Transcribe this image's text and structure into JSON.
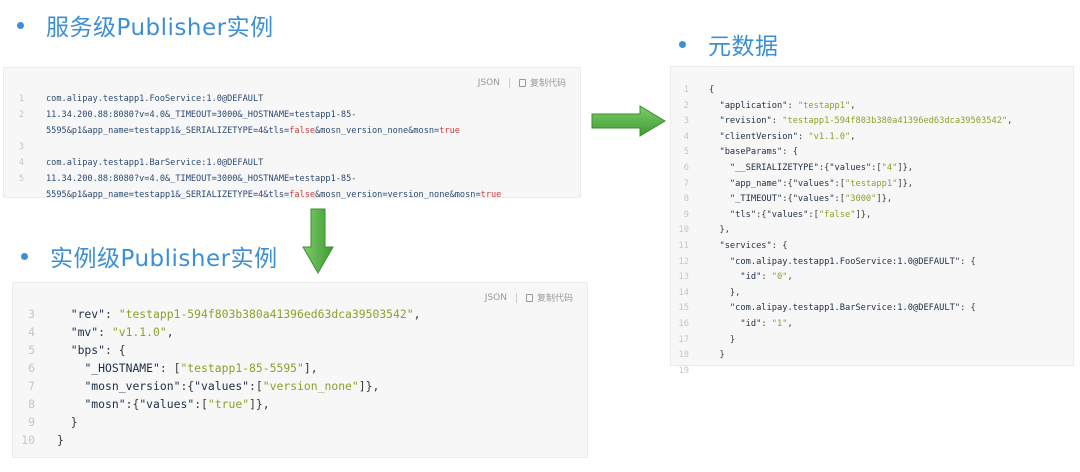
{
  "headings": {
    "service_publisher": "服务级Publisher实例",
    "instance_publisher": "实例级Publisher实例",
    "metadata": "元数据"
  },
  "toolbar": {
    "json_label": "JSON",
    "copy_label": "复制代码"
  },
  "service_panel": {
    "lines": [
      {
        "n": "1",
        "t": [
          [
            "com.alipay.testapp1.FooService:1.0@DEFAULT",
            "d"
          ]
        ]
      },
      {
        "n": "2",
        "t": [
          [
            "11.34.200.88:8080?v=4.0&_TIMEOUT=3000&_HOSTNAME=testapp1-85-",
            "d"
          ]
        ]
      },
      {
        "n": "",
        "t": [
          [
            "5595&p1&app_name=testapp1&_SERIALIZETYPE=4&tls=",
            "d"
          ],
          [
            "false",
            "b"
          ],
          [
            "&mosn_version_none&mosn=",
            "d"
          ],
          [
            "true",
            "b"
          ]
        ]
      },
      {
        "n": "3",
        "t": []
      },
      {
        "n": "4",
        "t": [
          [
            "com.alipay.testapp1.BarService:1.0@DEFAULT",
            "d"
          ]
        ]
      },
      {
        "n": "5",
        "t": [
          [
            "11.34.200.88:8080?v=4.0&_TIMEOUT=3000&_HOSTNAME=testapp1-85-",
            "d"
          ]
        ]
      },
      {
        "n": "",
        "t": [
          [
            "5595&p1&app_name=testapp1&_SERIALIZETYPE=4&tls=",
            "d"
          ],
          [
            "false",
            "b"
          ],
          [
            "&mosn_version=version_none&mosn=",
            "d"
          ],
          [
            "true",
            "b"
          ]
        ]
      }
    ]
  },
  "instance_panel": {
    "lines": [
      {
        "n": "3",
        "t": [
          [
            "  ",
            "p"
          ],
          [
            "\"rev\"",
            "k"
          ],
          [
            ": ",
            "p"
          ],
          [
            "\"testapp1-594f803b380a41396ed63dca39503542\"",
            "s"
          ],
          [
            ",",
            "p"
          ]
        ]
      },
      {
        "n": "4",
        "t": [
          [
            "  ",
            "p"
          ],
          [
            "\"mv\"",
            "k"
          ],
          [
            ": ",
            "p"
          ],
          [
            "\"v1.1.0\"",
            "s"
          ],
          [
            ",",
            "p"
          ]
        ]
      },
      {
        "n": "5",
        "t": [
          [
            "  ",
            "p"
          ],
          [
            "\"bps\"",
            "k"
          ],
          [
            ": {",
            "p"
          ]
        ]
      },
      {
        "n": "6",
        "t": [
          [
            "    ",
            "p"
          ],
          [
            "\"_HOSTNAME\"",
            "k"
          ],
          [
            ": [",
            "p"
          ],
          [
            "\"testapp1-85-5595\"",
            "s"
          ],
          [
            "],",
            "p"
          ]
        ]
      },
      {
        "n": "7",
        "t": [
          [
            "    ",
            "p"
          ],
          [
            "\"mosn_version\"",
            "k"
          ],
          [
            ":{",
            "p"
          ],
          [
            "\"values\"",
            "k"
          ],
          [
            ":[",
            "p"
          ],
          [
            "\"version_none\"",
            "s"
          ],
          [
            "]},",
            "p"
          ]
        ]
      },
      {
        "n": "8",
        "t": [
          [
            "    ",
            "p"
          ],
          [
            "\"mosn\"",
            "k"
          ],
          [
            ":{",
            "p"
          ],
          [
            "\"values\"",
            "k"
          ],
          [
            ":[",
            "p"
          ],
          [
            "\"true\"",
            "s"
          ],
          [
            "]},",
            "p"
          ]
        ]
      },
      {
        "n": "9",
        "t": [
          [
            "  }",
            "p"
          ]
        ]
      },
      {
        "n": "10",
        "t": [
          [
            "}",
            "p"
          ]
        ]
      }
    ]
  },
  "metadata_panel": {
    "lines": [
      {
        "n": "1",
        "t": [
          [
            "{",
            "p"
          ]
        ]
      },
      {
        "n": "2",
        "t": [
          [
            "  ",
            "p"
          ],
          [
            "\"application\"",
            "k"
          ],
          [
            ": ",
            "p"
          ],
          [
            "\"testapp1\"",
            "s"
          ],
          [
            ",",
            "p"
          ]
        ]
      },
      {
        "n": "3",
        "t": [
          [
            "  ",
            "p"
          ],
          [
            "\"revision\"",
            "k"
          ],
          [
            ": ",
            "p"
          ],
          [
            "\"testapp1-594f803b380a41396ed63dca39503542\"",
            "s"
          ],
          [
            ",",
            "p"
          ]
        ]
      },
      {
        "n": "4",
        "t": [
          [
            "  ",
            "p"
          ],
          [
            "\"clientVersion\"",
            "k"
          ],
          [
            ": ",
            "p"
          ],
          [
            "\"v1.1.0\"",
            "s"
          ],
          [
            ",",
            "p"
          ]
        ]
      },
      {
        "n": "5",
        "t": [
          [
            "  ",
            "p"
          ],
          [
            "\"baseParams\"",
            "k"
          ],
          [
            ": {",
            "p"
          ]
        ]
      },
      {
        "n": "6",
        "t": [
          [
            "    ",
            "p"
          ],
          [
            "\"__SERIALIZETYPE\"",
            "k"
          ],
          [
            ":{",
            "p"
          ],
          [
            "\"values\"",
            "k"
          ],
          [
            ":[",
            "p"
          ],
          [
            "\"4\"",
            "s"
          ],
          [
            "]},",
            "p"
          ]
        ]
      },
      {
        "n": "7",
        "t": [
          [
            "    ",
            "p"
          ],
          [
            "\"app_name\"",
            "k"
          ],
          [
            ":{",
            "p"
          ],
          [
            "\"values\"",
            "k"
          ],
          [
            ":[",
            "p"
          ],
          [
            "\"testapp1\"",
            "s"
          ],
          [
            "]},",
            "p"
          ]
        ]
      },
      {
        "n": "8",
        "t": [
          [
            "    ",
            "p"
          ],
          [
            "\"_TIMEOUT\"",
            "k"
          ],
          [
            ":{",
            "p"
          ],
          [
            "\"values\"",
            "k"
          ],
          [
            ":[",
            "p"
          ],
          [
            "\"3000\"",
            "s"
          ],
          [
            "]},",
            "p"
          ]
        ]
      },
      {
        "n": "9",
        "t": [
          [
            "    ",
            "p"
          ],
          [
            "\"tls\"",
            "k"
          ],
          [
            ":{",
            "p"
          ],
          [
            "\"values\"",
            "k"
          ],
          [
            ":[",
            "p"
          ],
          [
            "\"false\"",
            "s"
          ],
          [
            "]},",
            "p"
          ]
        ]
      },
      {
        "n": "10",
        "t": [
          [
            "  },",
            "p"
          ]
        ]
      },
      {
        "n": "11",
        "t": [
          [
            "  ",
            "p"
          ],
          [
            "\"services\"",
            "k"
          ],
          [
            ": {",
            "p"
          ]
        ]
      },
      {
        "n": "12",
        "t": [
          [
            "    ",
            "p"
          ],
          [
            "\"com.alipay.testapp1.FooService:1.0@DEFAULT\"",
            "k"
          ],
          [
            ": {",
            "p"
          ]
        ]
      },
      {
        "n": "13",
        "t": [
          [
            "      ",
            "p"
          ],
          [
            "\"id\"",
            "k"
          ],
          [
            ": ",
            "p"
          ],
          [
            "\"0\"",
            "s"
          ],
          [
            ",",
            "p"
          ]
        ]
      },
      {
        "n": "14",
        "t": [
          [
            "    },",
            "p"
          ]
        ]
      },
      {
        "n": "15",
        "t": [
          [
            "    ",
            "p"
          ],
          [
            "\"com.alipay.testapp1.BarService:1.0@DEFAULT\"",
            "k"
          ],
          [
            ": {",
            "p"
          ]
        ]
      },
      {
        "n": "16",
        "t": [
          [
            "      ",
            "p"
          ],
          [
            "\"id\"",
            "k"
          ],
          [
            ": ",
            "p"
          ],
          [
            "\"1\"",
            "s"
          ],
          [
            ",",
            "p"
          ]
        ]
      },
      {
        "n": "17",
        "t": [
          [
            "    }",
            "p"
          ]
        ]
      },
      {
        "n": "18",
        "t": [
          [
            "  }",
            "p"
          ]
        ]
      },
      {
        "n": "19",
        "t": []
      }
    ]
  },
  "colors": {
    "heading": "#3c8fd6",
    "arrow": "#5bb14a",
    "string": "#8f9f2a",
    "key": "#1e2e46",
    "boolean": "#cc3e3e"
  }
}
